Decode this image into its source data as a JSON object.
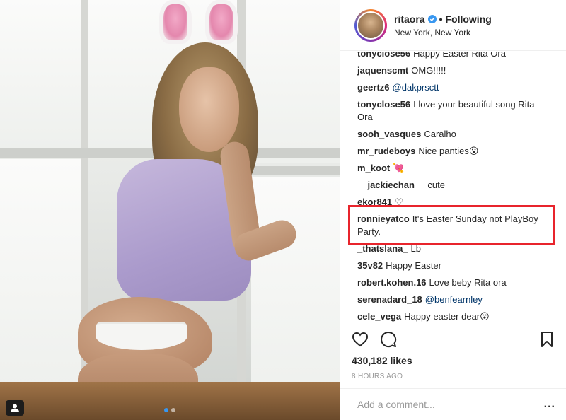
{
  "post": {
    "username": "ritaora",
    "separator": "•",
    "follow_status": "Following",
    "location": "New York, New York"
  },
  "comments": [
    {
      "user": "tonyclose56",
      "text": "Happy Easter Rita Ora"
    },
    {
      "user": "jaquenscmt",
      "text": "OMG!!!!!"
    },
    {
      "user": "geertz6",
      "text": "",
      "mention": "@dakprsctt"
    },
    {
      "user": "tonyclose56",
      "text": "I love your beautiful song Rita Ora"
    },
    {
      "user": "sooh_vasques",
      "text": "Caralho"
    },
    {
      "user": "mr_rudeboys",
      "text": "Nice panties😮"
    },
    {
      "user": "m_koot",
      "text": "💘"
    },
    {
      "user": "__jackiechan__",
      "text": "cute"
    },
    {
      "user": "ekor841",
      "text": "♡"
    },
    {
      "user": "ronnieyatco",
      "text": "It's Easter Sunday not PlayBoy Party."
    },
    {
      "user": "_thatslana_",
      "text": "Lb"
    },
    {
      "user": "35v82",
      "text": "Happy Easter"
    },
    {
      "user": "robert.kohen.16",
      "text": "Love beby Rita ora"
    },
    {
      "user": "serenadard_18",
      "text": "",
      "mention": "@benfearnley"
    },
    {
      "user": "cele_vega",
      "text": "Happy easter dear😮"
    }
  ],
  "stats": {
    "likes": "430,182 likes",
    "timestamp": "8 HOURS AGO"
  },
  "composer": {
    "placeholder": "Add a comment...",
    "more": "..."
  },
  "icons": {
    "like": "heart-icon",
    "comment": "speech-bubble-icon",
    "save": "bookmark-icon",
    "verified": "verified-badge-icon",
    "user_tag": "user-tag-icon"
  },
  "colors": {
    "verified": "#3897f0",
    "highlight": "#e8242c",
    "mention": "#003569"
  }
}
